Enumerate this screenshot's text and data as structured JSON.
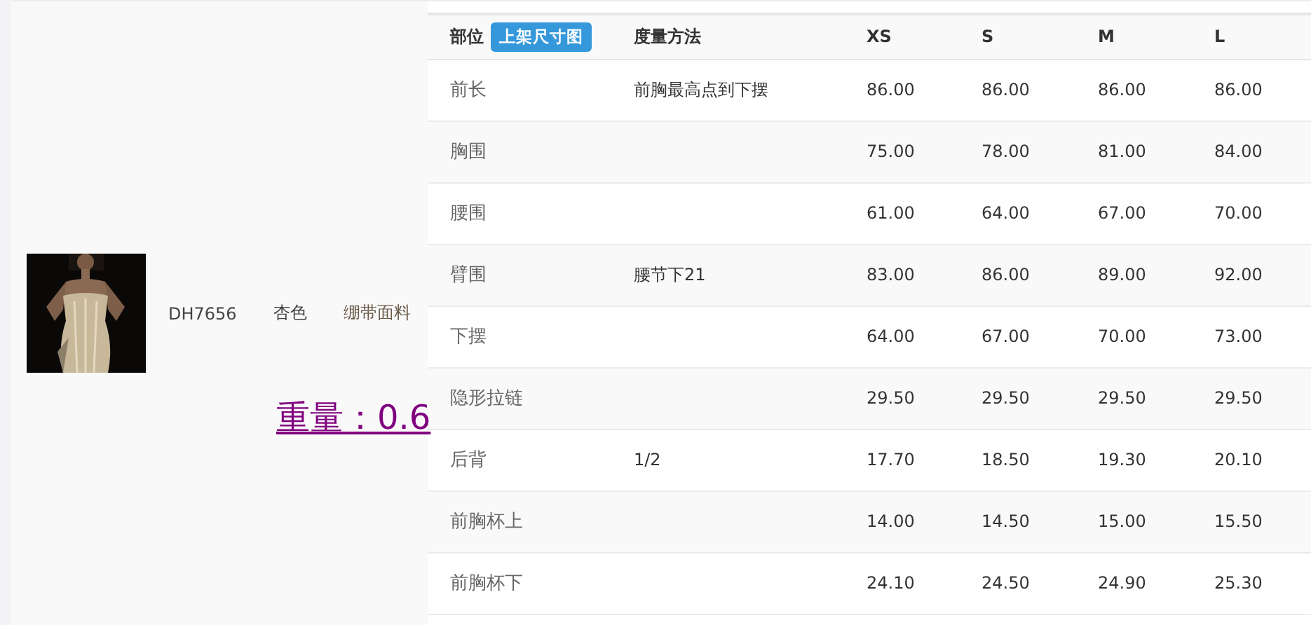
{
  "product": {
    "code": "DH7656",
    "color_name": "杏色",
    "material": "绷带面料"
  },
  "weight_link": "重量：0.6",
  "size_table": {
    "columns": [
      {
        "label": "部位",
        "badge": "上架尺寸图"
      },
      {
        "label": "度量方法"
      },
      {
        "label": "XS"
      },
      {
        "label": "S"
      },
      {
        "label": "M"
      },
      {
        "label": "L"
      }
    ],
    "rows": [
      [
        "前长",
        "前胸最高点到下摆",
        "86.00",
        "86.00",
        "86.00",
        "86.00"
      ],
      [
        "胸围",
        "",
        "75.00",
        "78.00",
        "81.00",
        "84.00"
      ],
      [
        "腰围",
        "",
        "61.00",
        "64.00",
        "67.00",
        "70.00"
      ],
      [
        "臂围",
        "腰节下21",
        "83.00",
        "86.00",
        "89.00",
        "92.00"
      ],
      [
        "下摆",
        "",
        "64.00",
        "67.00",
        "70.00",
        "73.00"
      ],
      [
        "隐形拉链",
        "",
        "29.50",
        "29.50",
        "29.50",
        "29.50"
      ],
      [
        "后背",
        "1/2",
        "17.70",
        "18.50",
        "19.30",
        "20.10"
      ],
      [
        "前胸杯上",
        "",
        "14.00",
        "14.50",
        "15.00",
        "15.50"
      ],
      [
        "前胸杯下",
        "",
        "24.10",
        "24.50",
        "24.90",
        "25.30"
      ]
    ]
  }
}
